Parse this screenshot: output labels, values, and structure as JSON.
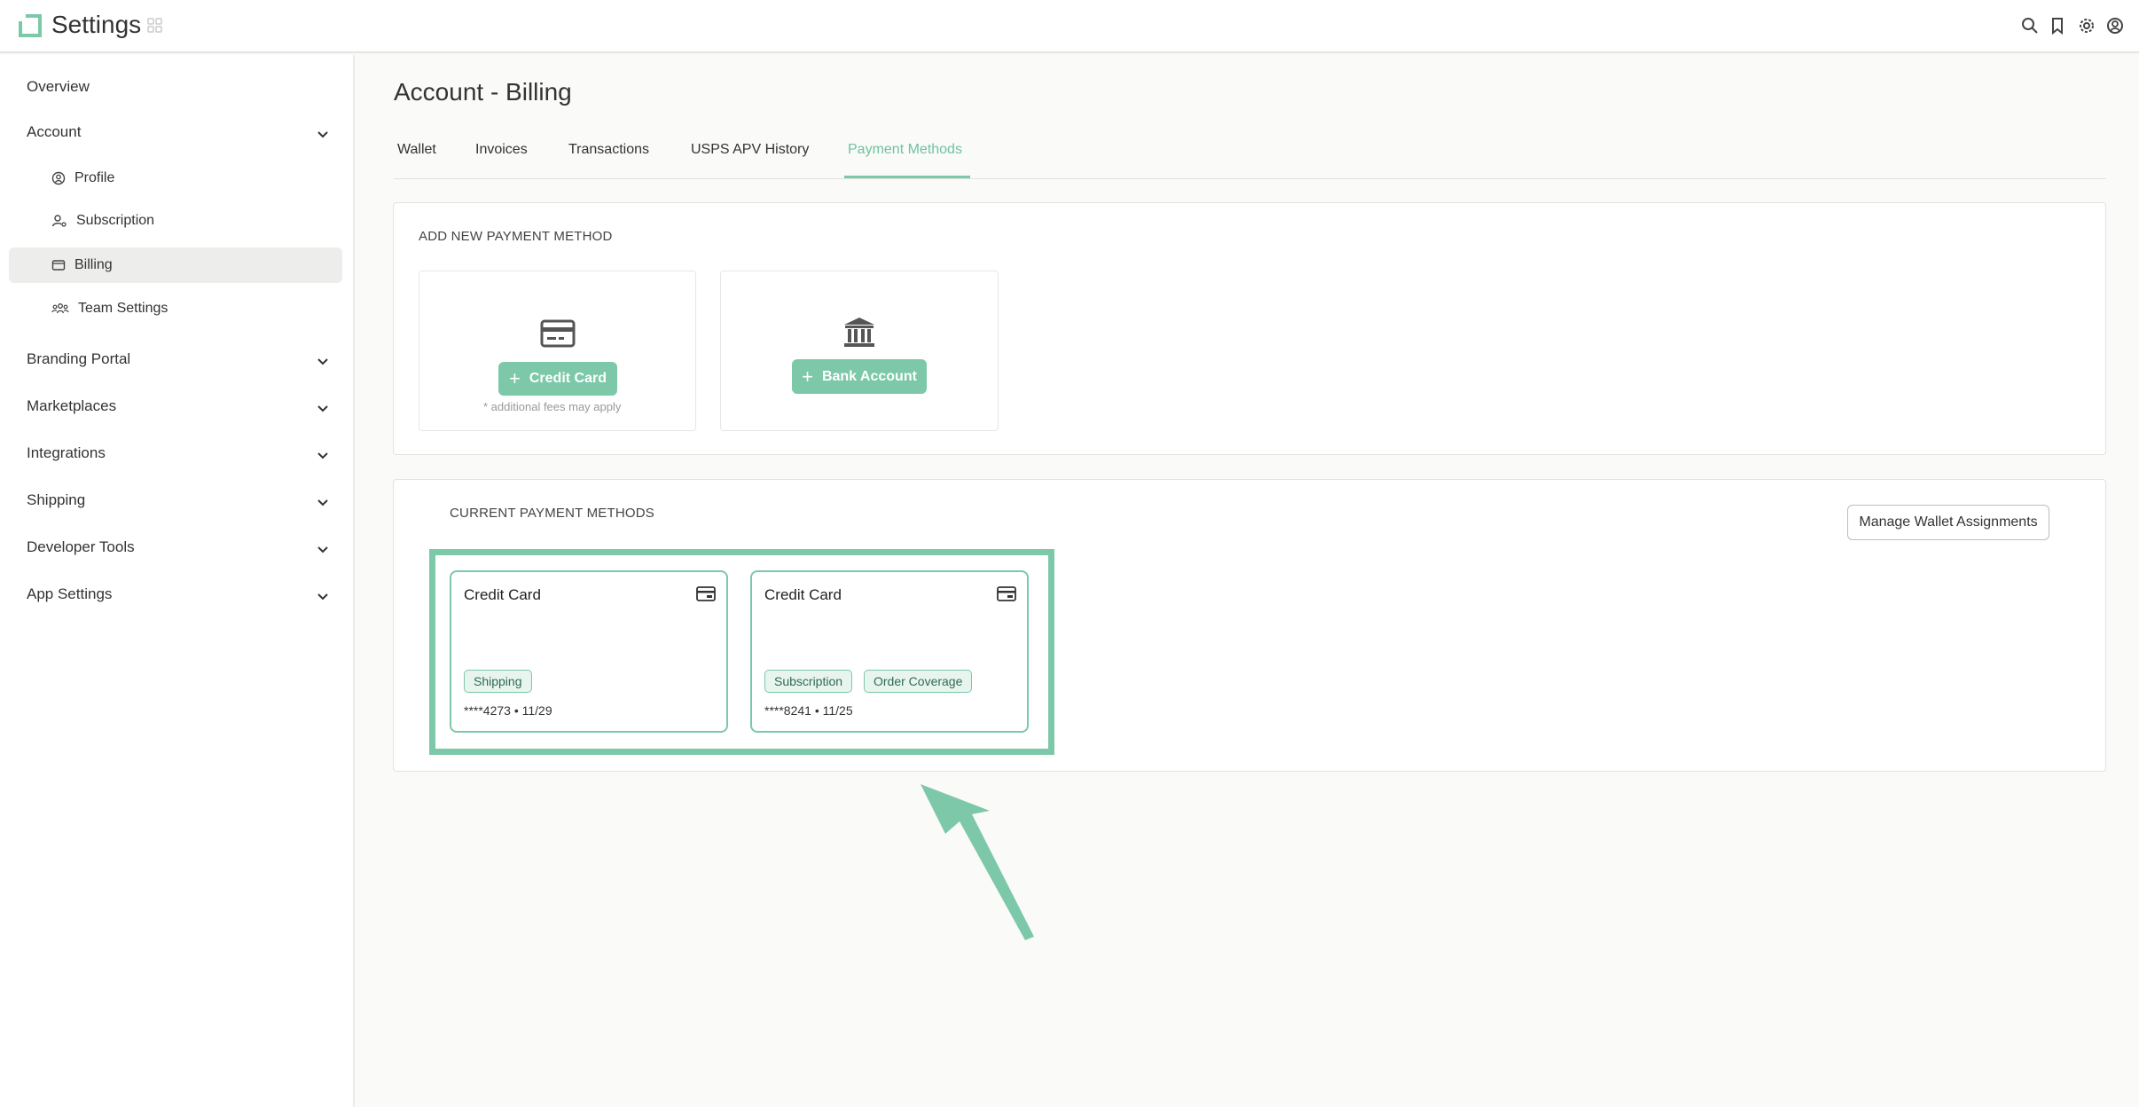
{
  "app": {
    "title": "Settings"
  },
  "sidebar": {
    "items": [
      {
        "label": "Overview"
      },
      {
        "label": "Account"
      },
      {
        "label": "Branding Portal"
      },
      {
        "label": "Marketplaces"
      },
      {
        "label": "Integrations"
      },
      {
        "label": "Shipping"
      },
      {
        "label": "Developer Tools"
      },
      {
        "label": "App Settings"
      }
    ],
    "account_subitems": [
      {
        "label": "Profile",
        "icon": "user-circle-icon"
      },
      {
        "label": "Subscription",
        "icon": "user-settings-icon"
      },
      {
        "label": "Billing",
        "icon": "wallet-icon",
        "active": true
      },
      {
        "label": "Team Settings",
        "icon": "team-icon"
      }
    ]
  },
  "main": {
    "title": "Account - Billing",
    "tabs": [
      {
        "label": "Wallet"
      },
      {
        "label": "Invoices"
      },
      {
        "label": "Transactions"
      },
      {
        "label": "USPS APV History"
      },
      {
        "label": "Payment Methods",
        "active": true
      }
    ],
    "add_section": {
      "label": "ADD NEW PAYMENT METHOD",
      "credit_card_button": "Credit Card",
      "credit_card_note": "* additional fees may apply",
      "bank_account_button": "Bank Account"
    },
    "current_section": {
      "label": "CURRENT PAYMENT METHODS",
      "manage_button": "Manage Wallet Assignments",
      "cards": [
        {
          "title": "Credit Card",
          "tags": [
            "Shipping"
          ],
          "number": "****4273 • 11/29"
        },
        {
          "title": "Credit Card",
          "tags": [
            "Subscription",
            "Order Coverage"
          ],
          "number": "****8241 • 11/25"
        }
      ]
    }
  },
  "colors": {
    "accent": "#7cc8a9",
    "accent_text": "#6ec3a0"
  }
}
